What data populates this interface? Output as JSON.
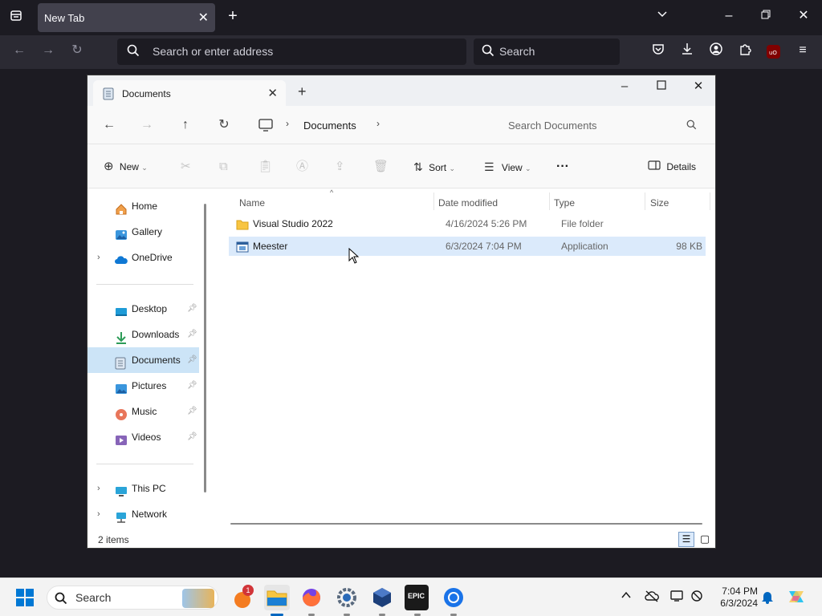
{
  "browser": {
    "tab_title": "New Tab",
    "address_placeholder": "Search or enter address",
    "search_placeholder": "Search"
  },
  "explorer": {
    "tab_title": "Documents",
    "breadcrumb": "Documents",
    "search_placeholder": "Search Documents",
    "toolbar": {
      "new_label": "New",
      "sort_label": "Sort",
      "view_label": "View",
      "more_label": "···",
      "details_label": "Details"
    },
    "sidebar": {
      "top": [
        {
          "label": "Home"
        },
        {
          "label": "Gallery"
        },
        {
          "label": "OneDrive"
        }
      ],
      "quick": [
        {
          "label": "Desktop"
        },
        {
          "label": "Downloads"
        },
        {
          "label": "Documents"
        },
        {
          "label": "Pictures"
        },
        {
          "label": "Music"
        },
        {
          "label": "Videos"
        }
      ],
      "bottom": [
        {
          "label": "This PC"
        },
        {
          "label": "Network"
        }
      ]
    },
    "columns": [
      "Name",
      "Date modified",
      "Type",
      "Size"
    ],
    "files": [
      {
        "name": "Visual Studio 2022",
        "date": "4/16/2024 5:26 PM",
        "type": "File folder",
        "size": ""
      },
      {
        "name": "Meester",
        "date": "6/3/2024 7:04 PM",
        "type": "Application",
        "size": "98 KB"
      }
    ],
    "status": "2 items"
  },
  "taskbar": {
    "search_label": "Search",
    "notification_badge": "1",
    "clock_time": "7:04 PM",
    "clock_date": "6/3/2024",
    "epic_label": "EPIC"
  },
  "colors": {
    "accent": "#0067c0",
    "selection": "#cce4f7",
    "folder": "#f8c542",
    "browser_bg": "#1c1b22"
  }
}
